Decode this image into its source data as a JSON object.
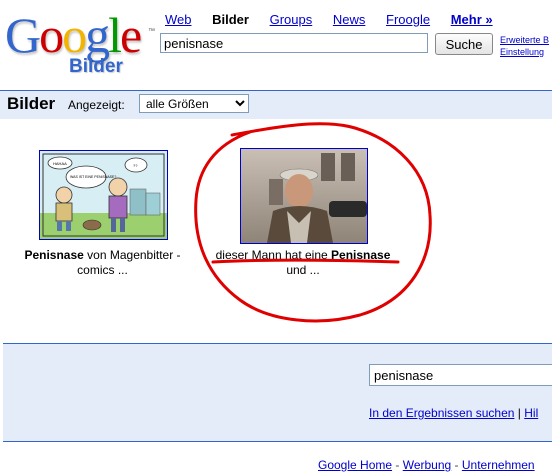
{
  "logo": {
    "letters": [
      "G",
      "o",
      "o",
      "g",
      "l",
      "e"
    ],
    "colors": [
      "#3366cc",
      "#cc0000",
      "#f1b400",
      "#3366cc",
      "#009900",
      "#cc0000"
    ],
    "subtitle": "Bilder",
    "tm": "™"
  },
  "nav": {
    "items": [
      "Web",
      "Bilder",
      "Groups",
      "News",
      "Froogle"
    ],
    "current": "Bilder",
    "more": "Mehr »"
  },
  "search": {
    "value": "penisnase",
    "button": "Suche",
    "advanced": "Erweiterte B",
    "settings": "Einstellung"
  },
  "bar": {
    "title": "Bilder",
    "shown_label": "Angezeigt:",
    "size_option": "alle Größen"
  },
  "results": [
    {
      "bold": "Penisnase",
      "text1": " von Magenbitter -",
      "text2": "comics ..."
    },
    {
      "text_pre": "dieser Mann hat eine ",
      "bold": "Penisnase",
      "text2": "und ..."
    }
  ],
  "comic": {
    "bubbles": [
      "HAHAA",
      "WAS IST EINE PENISNASE?",
      "??"
    ]
  },
  "bottom": {
    "value": "penisnase",
    "search_in_results": "In den Ergebnissen suchen",
    "help": "Hil"
  },
  "footer": {
    "home": "Google Home",
    "sep": " - ",
    "ads": "Werbung",
    "company": "Unternehmen"
  },
  "colors": {
    "link": "#0000cc",
    "bar_bg": "#e5ecf9",
    "bar_border": "#3366cc",
    "annotation_red": "#e00000"
  }
}
